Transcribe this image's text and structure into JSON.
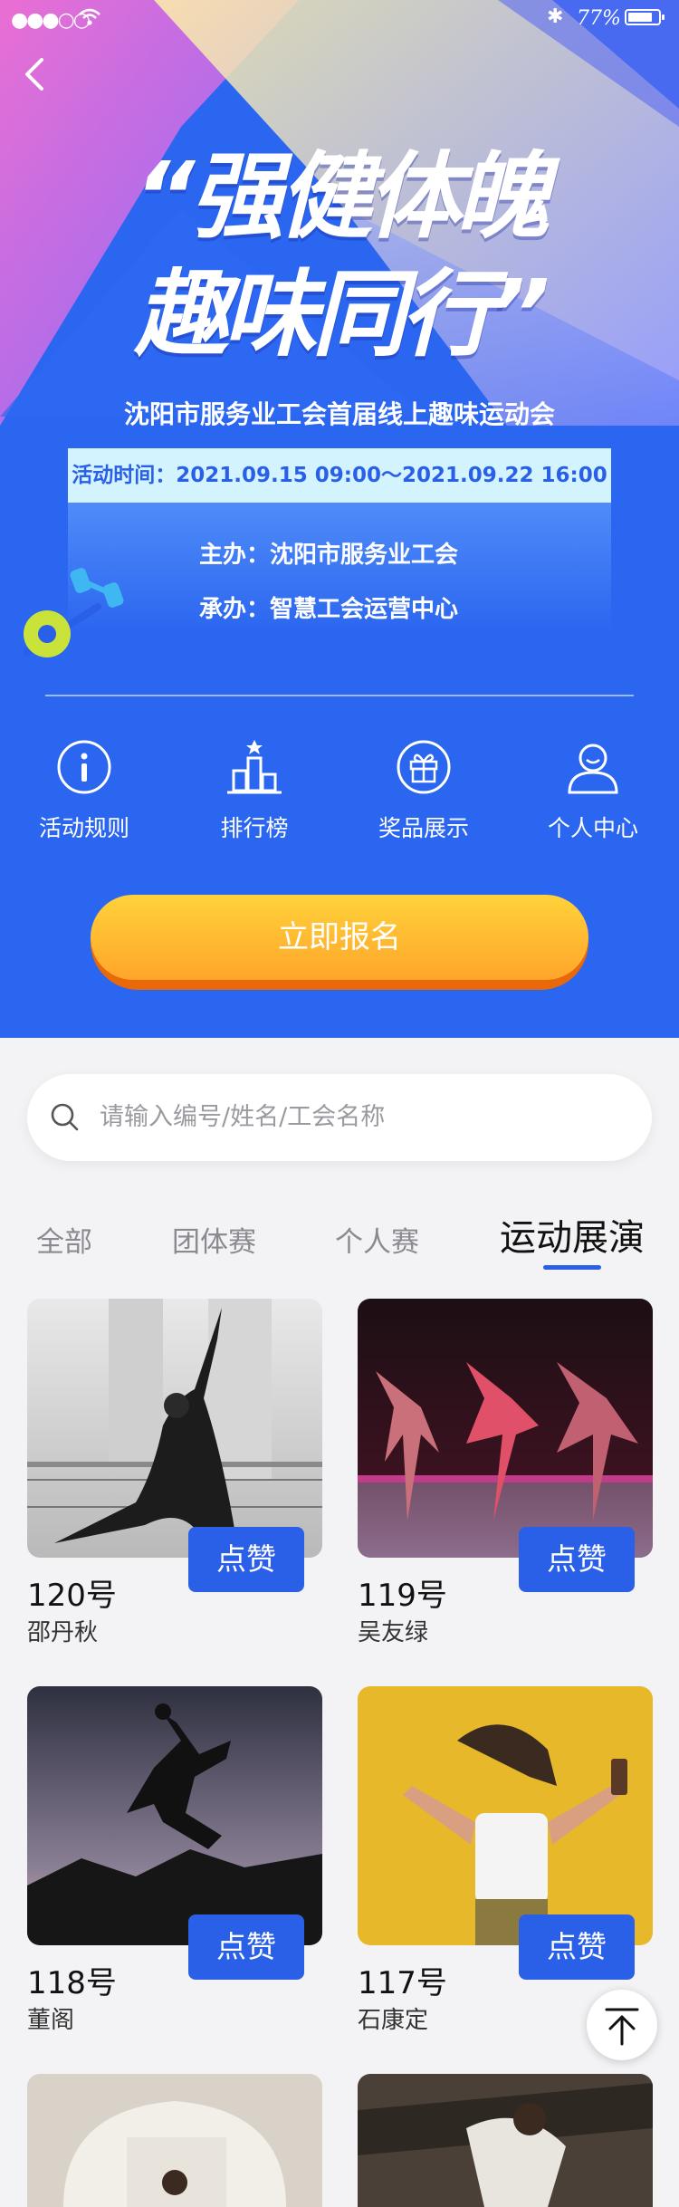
{
  "status_bar": {
    "signal": "●●●○○",
    "battery_text": "77%"
  },
  "hero": {
    "title_line1": "“强健体魄",
    "title_line2": "趣味同行”",
    "subtitle": "沈阳市服务业工会首届线上趣味运动会",
    "time_text": "活动时间：2021.09.15 09:00～2021.09.22 16:00",
    "organizer": "主办：沈阳市服务业工会",
    "co_organizer": "承办：智慧工会运营中心"
  },
  "nav_items": [
    {
      "label": "活动规则",
      "icon": "info-icon"
    },
    {
      "label": "排行榜",
      "icon": "ranking-icon"
    },
    {
      "label": "奖品展示",
      "icon": "gift-icon"
    },
    {
      "label": "个人中心",
      "icon": "user-icon"
    }
  ],
  "cta_label": "立即报名",
  "search": {
    "placeholder": "请输入编号/姓名/工会名称"
  },
  "tabs": [
    {
      "label": "全部",
      "active": false
    },
    {
      "label": "团体赛",
      "active": false
    },
    {
      "label": "个人赛",
      "active": false
    },
    {
      "label": "运动展演",
      "active": true
    }
  ],
  "entries": [
    {
      "number": "120号",
      "name": "邵丹秋",
      "like_label": "点赞"
    },
    {
      "number": "119号",
      "name": "吴友绿",
      "like_label": "点赞"
    },
    {
      "number": "118号",
      "name": "董阁",
      "like_label": "点赞"
    },
    {
      "number": "117号",
      "name": "石康定",
      "like_label": "点赞"
    }
  ],
  "colors": {
    "primary": "#2a5fe8",
    "cta_top": "#ffd23a",
    "cta_bottom": "#ffa52a",
    "background": "#f3f3f5"
  }
}
